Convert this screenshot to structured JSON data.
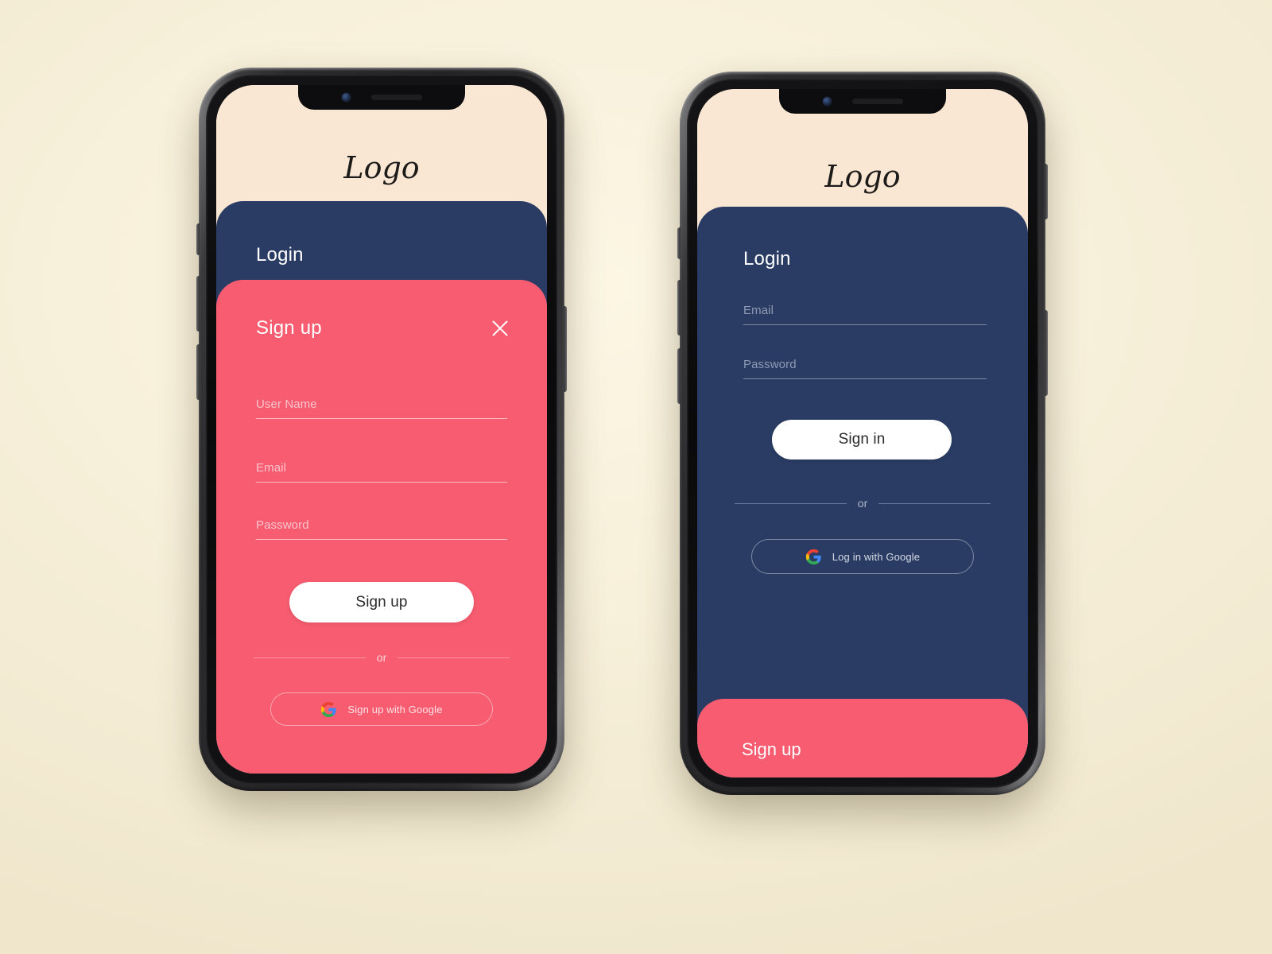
{
  "colors": {
    "page_background": "#F3ECD8",
    "screen_cream": "#F9E6D3",
    "navy": "#2A3C63",
    "pink": "#F75C70",
    "white": "#FFFFFF",
    "pink_label": "#FBC3CC",
    "navy_label": "#8D9AB4"
  },
  "screens": {
    "signup": {
      "logo": "Logo",
      "login_panel_title": "Login",
      "card_title": "Sign up",
      "close_icon": "close-icon",
      "fields": [
        {
          "label": "User Name",
          "value": "",
          "placeholder": "User Name"
        },
        {
          "label": "Email",
          "value": "",
          "placeholder": "Email"
        },
        {
          "label": "Password",
          "value": "",
          "placeholder": "Password"
        }
      ],
      "primary_button": "Sign up",
      "divider_label": "or",
      "google_button": "Sign up with Google",
      "google_icon": "google-g-icon"
    },
    "login": {
      "logo": "Logo",
      "panel_title": "Login",
      "fields": [
        {
          "label": "Email",
          "value": "",
          "placeholder": "Email"
        },
        {
          "label": "Password",
          "value": "",
          "placeholder": "Password"
        }
      ],
      "primary_button": "Sign in",
      "divider_label": "or",
      "google_button": "Log in with Google",
      "google_icon": "google-g-icon",
      "bottom_cta": "Sign up"
    }
  }
}
